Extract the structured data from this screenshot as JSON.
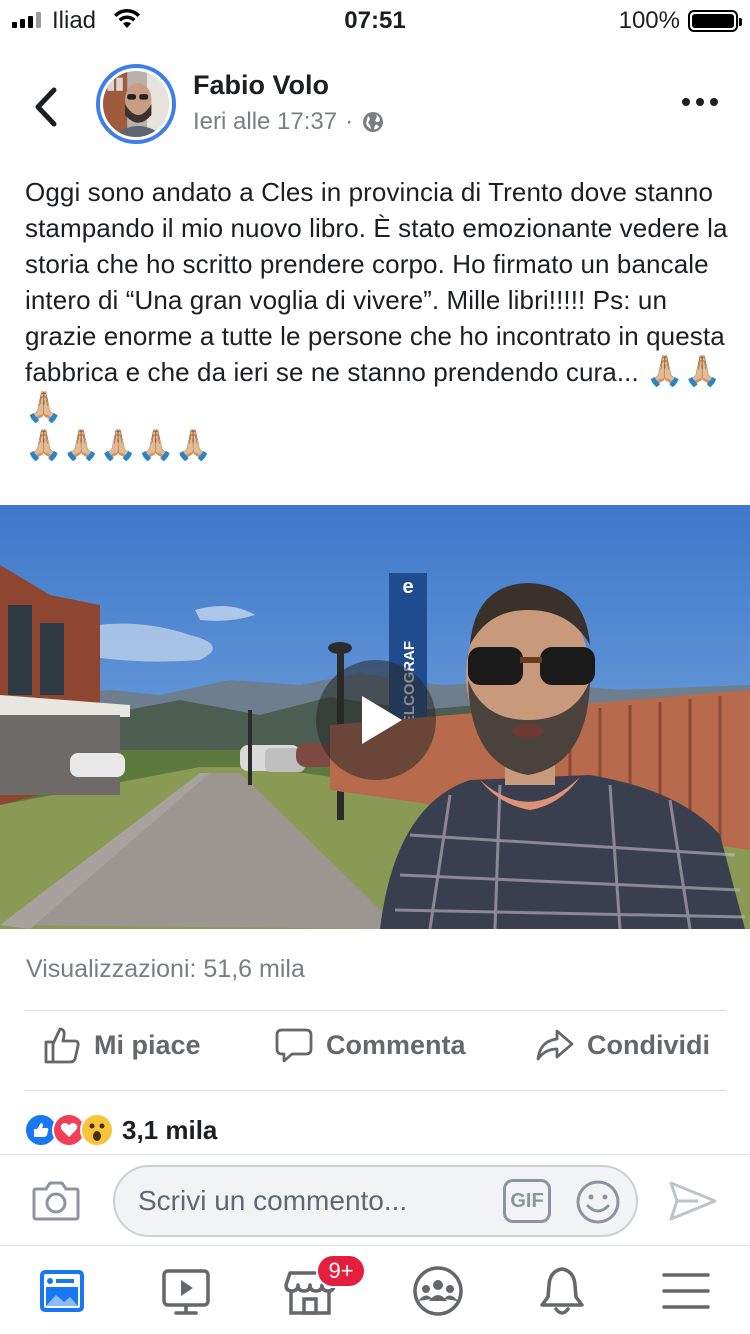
{
  "status_bar": {
    "carrier": "Iliad",
    "time": "07:51",
    "battery": "100%"
  },
  "post": {
    "author": "Fabio Volo",
    "timestamp": "Ieri alle 17:37",
    "separator": "·",
    "privacy_icon": "globe-icon",
    "text": "Oggi sono andato a Cles in provincia di Trento dove stanno stampando il mio nuovo libro. È stato emozionante vedere la storia che ho scritto prendere corpo.   Ho firmato un bancale intero di “Una gran voglia di vivere”.  Mille libri!!!!!      Ps: un grazie enorme a tutte le persone che ho incontrato in questa fabbrica e che da ieri se ne stanno prendendo cura...",
    "emoji_inline": "🙏🏼🙏🏼🙏🏼",
    "emoji_line": "🙏🏼🙏🏼🙏🏼🙏🏼🙏🏼",
    "video": {
      "sign_brand": "ELCOGRAF",
      "sign_logo": "e"
    },
    "views": "Visualizzazioni: 51,6 mila"
  },
  "actions": {
    "like": "Mi piace",
    "comment": "Commenta",
    "share": "Condividi"
  },
  "reactions": {
    "count": "3,1 mila",
    "types": [
      "like-reaction-icon",
      "love-reaction-icon",
      "wow-reaction-icon"
    ]
  },
  "comment_box": {
    "placeholder": "Scrivi un commento...",
    "gif": "GIF"
  },
  "nav": {
    "marketplace_badge": "9+"
  },
  "colors": {
    "accent": "#3d7ee8",
    "like_blue": "#1877f2",
    "love_red": "#f33e58",
    "badge_red": "#e41e3f",
    "text_gray": "#65676b"
  }
}
